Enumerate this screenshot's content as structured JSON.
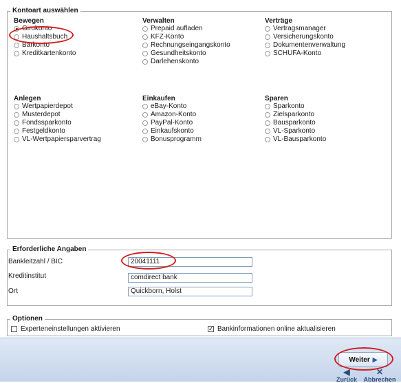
{
  "kontoart": {
    "legend": "Kontoart auswählen",
    "groups": [
      {
        "title": "Bewegen",
        "options": [
          "Girokonto",
          "Haushaltsbuch",
          "Barkonto",
          "Kreditkartenkonto"
        ],
        "selected": 0
      },
      {
        "title": "Verwalten",
        "options": [
          "Prepaid aufladen",
          "KFZ-Konto",
          "Rechnungseingangskonto",
          "Gesundheitskonto",
          "Darlehenskonto"
        ]
      },
      {
        "title": "Verträge",
        "options": [
          "Vertragsmanager",
          "Versicherungskonto",
          "Dokumentenverwaltung",
          "SCHUFA-Konto"
        ]
      },
      {
        "title": "Anlegen",
        "options": [
          "Wertpapierdepot",
          "Musterdepot",
          "Fondssparkonto",
          "Festgeldkonto",
          "VL-Wertpapiersparvertrag"
        ]
      },
      {
        "title": "Einkaufen",
        "options": [
          "eBay-Konto",
          "Amazon-Konto",
          "PayPal-Konto",
          "Einkaufskonto",
          "Bonusprogramm"
        ]
      },
      {
        "title": "Sparen",
        "options": [
          "Sparkonto",
          "Zielsparkonto",
          "Bausparkonto",
          "VL-Sparkonto",
          "VL-Bausparkonto"
        ]
      }
    ]
  },
  "angaben": {
    "legend": "Erforderliche Angaben",
    "bankleitzahl_label": "Bankleitzahl / BIC",
    "bankleitzahl_value": "20041111",
    "kreditinstitut_label": "Kreditinstitut",
    "kreditinstitut_value": "comdirect bank",
    "ort_label": "Ort",
    "ort_value": "Quickborn, Holst"
  },
  "optionen": {
    "legend": "Optionen",
    "experten_label": "Experteneinstellungen aktivieren",
    "experten_checked": false,
    "bankinfo_label": "Bankinformationen online aktualisieren",
    "bankinfo_checked": true
  },
  "buttons": {
    "weiter": "Weiter",
    "zurueck": "Zurück",
    "abbrechen": "Abbrechen"
  },
  "colors": {
    "highlight_ring": "#d21e1e",
    "bar_top": "#dfe9f6",
    "bar_bottom": "#c4d4ea"
  }
}
